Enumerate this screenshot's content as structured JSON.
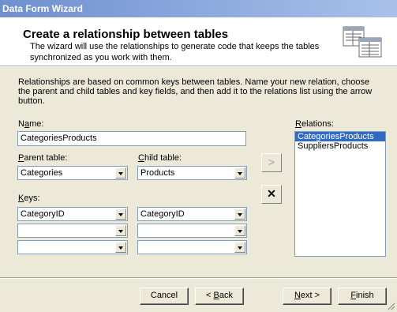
{
  "window": {
    "title": "Data Form Wizard"
  },
  "header": {
    "title": "Create a relationship between tables",
    "description": "The wizard will use the relationships to generate code that keeps the tables synchronized as you work with them.",
    "icon": "table-relationship-icon"
  },
  "intro_text": "Relationships are based on common keys between tables. Name your new relation, choose the parent and child tables and key fields, and then add it to the relations list using the arrow button.",
  "name_field": {
    "label_pre": "N",
    "label_mn": "a",
    "label_post": "me:",
    "value": "CategoriesProducts"
  },
  "parent_table": {
    "label_mn": "P",
    "label_post": "arent table:",
    "value": "Categories"
  },
  "child_table": {
    "label_mn": "C",
    "label_post": "hild table:",
    "value": "Products"
  },
  "keys": {
    "label_mn": "K",
    "label_post": "eys:",
    "rows": [
      {
        "parent": "CategoryID",
        "child": "CategoryID"
      },
      {
        "parent": "",
        "child": ""
      },
      {
        "parent": "",
        "child": ""
      }
    ]
  },
  "relations": {
    "label_mn": "R",
    "label_post": "elations:",
    "items": [
      "CategoriesProducts",
      "SuppliersProducts"
    ],
    "selected_index": 0
  },
  "add_button": {
    "glyph": ">"
  },
  "delete_button": {
    "glyph": "✕"
  },
  "footer": {
    "cancel": "Cancel",
    "back_pre": "< ",
    "back_mn": "B",
    "back_post": "ack",
    "next_mn": "N",
    "next_post": "ext >",
    "finish_mn": "F",
    "finish_post": "inish"
  },
  "colors": {
    "title_gradient_start": "#6f8fcf",
    "selection": "#316ac5",
    "face": "#ece9d8"
  }
}
